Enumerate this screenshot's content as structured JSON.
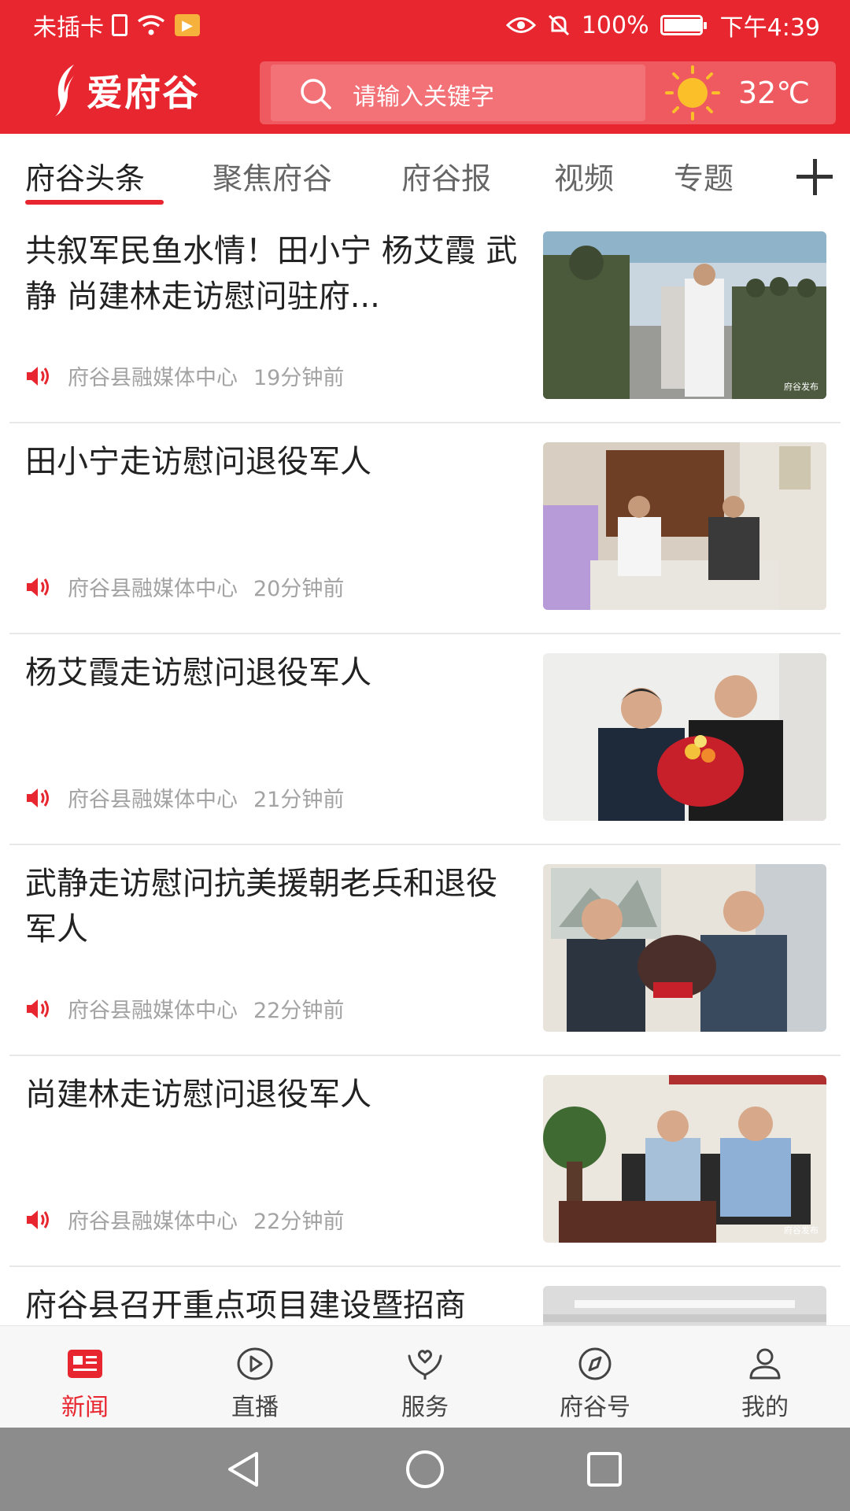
{
  "status_bar": {
    "carrier": "未插卡",
    "battery": "100%",
    "battery_level": 1.0,
    "time": "下午4:39"
  },
  "header": {
    "logo_text": "爱府谷",
    "search_placeholder": "请输入关键字",
    "temperature": "32℃",
    "weather_icon": "sun-icon",
    "brand_color": "#e8262f"
  },
  "tabs": [
    {
      "label": "府谷头条",
      "active": true
    },
    {
      "label": "聚焦府谷",
      "active": false
    },
    {
      "label": "府谷报",
      "active": false
    },
    {
      "label": "视频",
      "active": false
    },
    {
      "label": "专题",
      "active": false
    }
  ],
  "feed": [
    {
      "title": "共叙军民鱼水情！田小宁 杨艾霞 武静 尚建林走访慰问驻府...",
      "source": "府谷县融媒体中心",
      "time": "19分钟前",
      "watermark": "府谷发布"
    },
    {
      "title": "田小宁走访慰问退役军人",
      "source": "府谷县融媒体中心",
      "time": "20分钟前",
      "watermark": ""
    },
    {
      "title": "杨艾霞走访慰问退役军人",
      "source": "府谷县融媒体中心",
      "time": "21分钟前",
      "watermark": ""
    },
    {
      "title": "武静走访慰问抗美援朝老兵和退役军人",
      "source": "府谷县融媒体中心",
      "time": "22分钟前",
      "watermark": ""
    },
    {
      "title": "尚建林走访慰问退役军人",
      "source": "府谷县融媒体中心",
      "time": "22分钟前",
      "watermark": "府谷发布"
    },
    {
      "title": "府谷县召开重点项目建设暨招商",
      "source": "",
      "time": "",
      "watermark": ""
    }
  ],
  "bottom_nav": [
    {
      "label": "新闻",
      "icon": "news-icon",
      "active": true
    },
    {
      "label": "直播",
      "icon": "play-icon",
      "active": false
    },
    {
      "label": "服务",
      "icon": "heart-hands-icon",
      "active": false
    },
    {
      "label": "府谷号",
      "icon": "compass-icon",
      "active": false
    },
    {
      "label": "我的",
      "icon": "person-icon",
      "active": false
    }
  ]
}
